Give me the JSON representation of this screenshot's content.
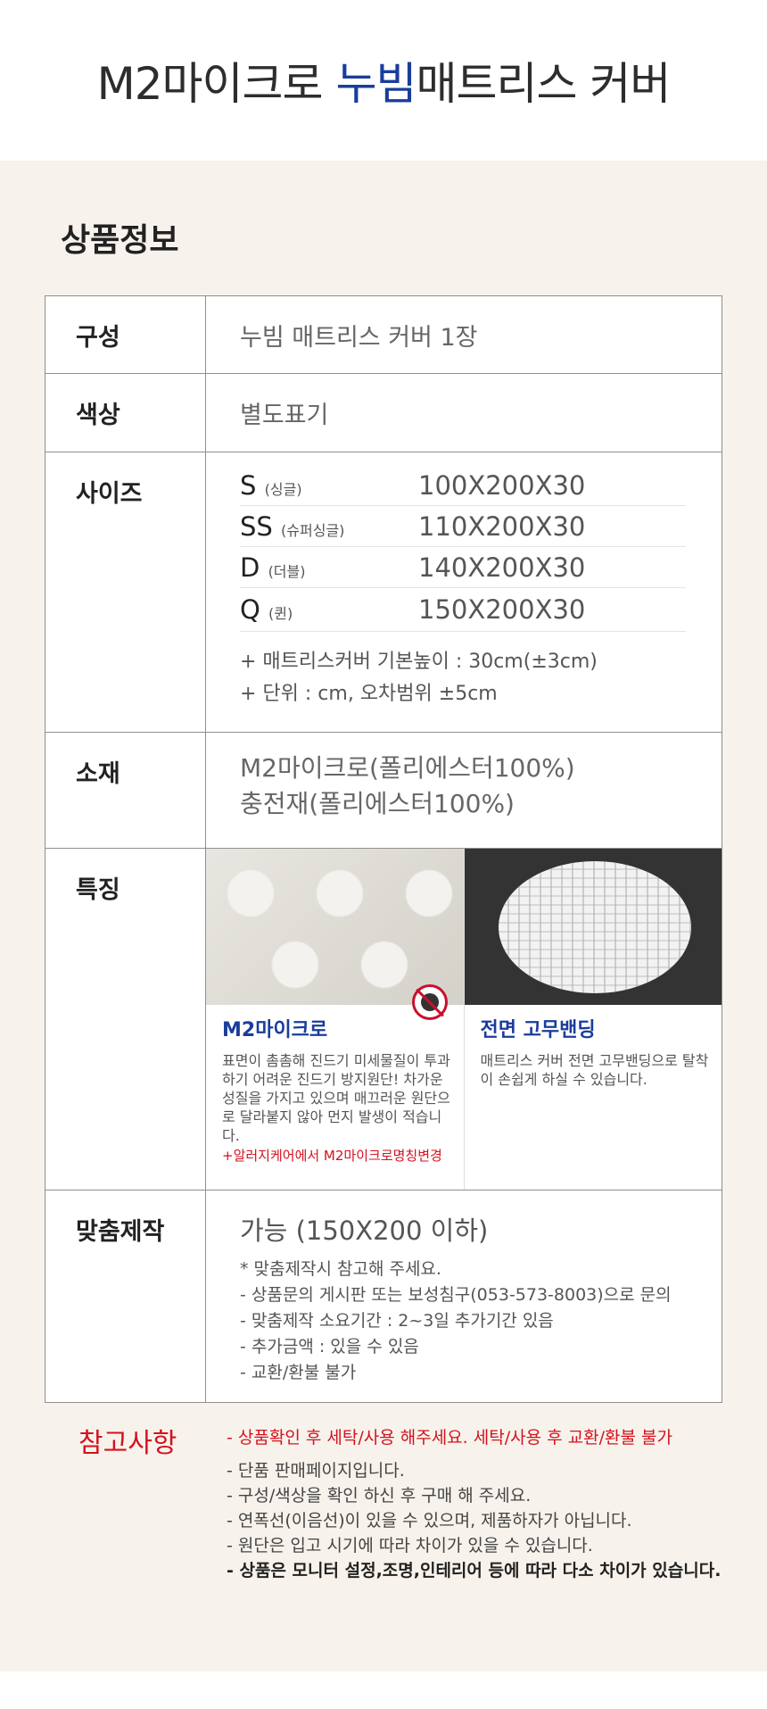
{
  "header": {
    "title_pre": "M2마이크로 ",
    "title_hl": "누빔",
    "title_post": "매트리스 커버"
  },
  "section_title": "상품정보",
  "rows": {
    "composition": {
      "label": "구성",
      "value": "누빔 매트리스 커버 1장"
    },
    "color": {
      "label": "색상",
      "value": "별도표기"
    },
    "size": {
      "label": "사이즈",
      "items": [
        {
          "code": "S",
          "name": "(싱글)",
          "dim": "100X200X30"
        },
        {
          "code": "SS",
          "name": "(슈퍼싱글)",
          "dim": "110X200X30"
        },
        {
          "code": "D",
          "name": "(더블)",
          "dim": "140X200X30"
        },
        {
          "code": "Q",
          "name": "(퀸)",
          "dim": "150X200X30"
        }
      ],
      "note1": "+ 매트리스커버 기본높이 : 30cm(±3cm)",
      "note2": "+ 단위 : cm, 오차범위 ±5cm"
    },
    "material": {
      "label": "소재",
      "line1": "M2마이크로(폴리에스터100%)",
      "line2": "충전재(폴리에스터100%)"
    },
    "feature": {
      "label": "특징",
      "f1": {
        "title": "M2마이크로",
        "desc": "표면이 촘촘해 진드기 미세물질이 투과하기 어려운 진드기 방지원단! 차가운 성질을 가지고 있으며 매끄러운 원단으로 달라붙지 않아 먼지 발생이 적습니다.",
        "red": "+알러지케어에서 M2마이크로명칭변경"
      },
      "f2": {
        "title": "전면 고무밴딩",
        "desc": "매트리스 커버 전면 고무밴딩으로 탈착이 손쉽게  하실 수 있습니다."
      }
    },
    "custom": {
      "label": "맞춤제작",
      "main": "가능 (150X200 이하)",
      "notes": [
        "* 맞춤제작시 참고해 주세요.",
        "- 상품문의 게시판 또는 보성침구(053-573-8003)으로 문의",
        "- 맞춤제작 소요기간 : 2~3일 추가기간 있음",
        "- 추가금액 : 있을 수 있음",
        "- 교환/환불 불가"
      ]
    }
  },
  "reference": {
    "label": "참고사항",
    "red": "- 상품확인 후 세탁/사용 해주세요. 세탁/사용 후 교환/환불 불가",
    "items": [
      "- 단품 판매페이지입니다.",
      "- 구성/색상을 확인 하신 후 구매 해 주세요.",
      "- 연폭선(이음선)이 있을 수 있으며, 제품하자가 아닙니다.",
      "- 원단은 입고 시기에 따라 차이가 있을 수 있습니다."
    ],
    "bold": "- 상품은 모니터 설정,조명,인테리어 등에 따라 다소 차이가 있습니다."
  },
  "colors": {
    "accent_blue": "#1a3d9c",
    "accent_red": "#d4121e",
    "panel_bg": "#f7f3ec"
  },
  "icons": [
    "no-mite-icon"
  ]
}
